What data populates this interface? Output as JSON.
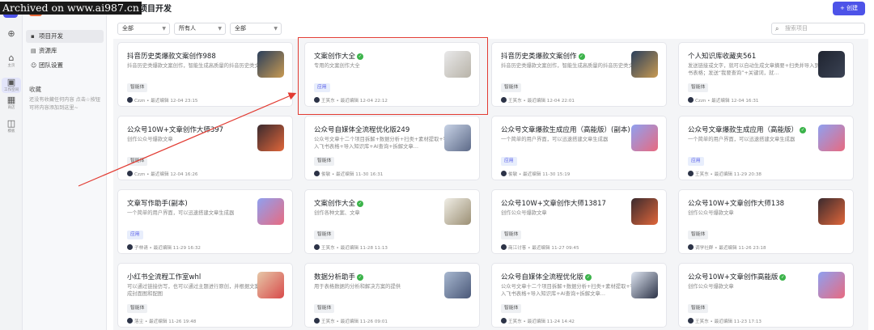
{
  "watermark": "Archived on www.ai987.cn",
  "rail": [
    {
      "icon": "⊕",
      "label": ""
    },
    {
      "icon": "⌂",
      "label": "主页"
    },
    {
      "icon": "▣",
      "label": "工作空间"
    },
    {
      "icon": "▦",
      "label": "商店"
    },
    {
      "icon": "◫",
      "label": "模板"
    }
  ],
  "sidebar": {
    "items": [
      {
        "icon": "▪",
        "label": "项目开发"
      },
      {
        "icon": "▤",
        "label": "资源库"
      },
      {
        "icon": "☺",
        "label": "团队设置"
      }
    ],
    "fav_title": "收藏",
    "fav_empty": "还没有收藏任何内容 点击☆按钮可将内容添加到这里~"
  },
  "header": {
    "title": "项目开发",
    "create_label": "+ 创建"
  },
  "filters": [
    {
      "value": "全部"
    },
    {
      "value": "所有人"
    },
    {
      "value": "全部"
    }
  ],
  "search": {
    "placeholder": "搜索项目"
  },
  "cards": [
    {
      "title": "抖音历史类爆款文案创作988",
      "verified": false,
      "desc": "抖音历史类爆款文案创作，智能生成高质量的抖音历史类文案",
      "tag": "智能体",
      "tag_type": "agent",
      "footer": "Czzn • 最近编辑 12-04 23:15"
    },
    {
      "title": "文案创作大全",
      "verified": true,
      "desc": "专用的文案创作大全",
      "tag": "应用",
      "tag_type": "app",
      "footer": "王笑东 • 最近编辑 12-04 22:12"
    },
    {
      "title": "抖音历史类爆款文案创作",
      "verified": true,
      "desc": "抖音历史类爆款文案创作，智能生成高质量的抖音历史类文案",
      "tag": "智能体",
      "tag_type": "agent",
      "footer": "王笑东 • 最近编辑 12-04 22:01"
    },
    {
      "title": "个人知识库收藏夹561",
      "verified": false,
      "desc": "发送链接或文字，就可以自动生成文章摘要+扫类并导入到飞书表格；发送“我要查询”+关键词，就…",
      "tag": "智能体",
      "tag_type": "agent",
      "footer": "Czzn • 最近编辑 12-04 16:31"
    },
    {
      "title": "公众号10W+文章创作大师397",
      "verified": false,
      "desc": "创作公众号爆款文章",
      "tag": "智能体",
      "tag_type": "agent",
      "footer": "Czzn • 最近编辑 12-04 16:26"
    },
    {
      "title": "公众号自媒体全流程优化版249",
      "verified": false,
      "desc": "公众号文章十二个项目拆解+数据分析+扫类+素材提取+导入飞书表格+导入知识库+AI查询+拆解文章…",
      "tag": "智能体",
      "tag_type": "agent",
      "footer": "俊敏 • 最近编辑 11-30 16:31"
    },
    {
      "title": "公众号文章爆款生成应用（高能版）(副本)",
      "verified": false,
      "desc": "一个简单的用户界面，可以迅速搭建文章生成器",
      "tag": "应用",
      "tag_type": "app",
      "footer": "俊敏 • 最近编辑 11-30 15:19"
    },
    {
      "title": "公众号文章爆款生成应用（高能版）",
      "verified": true,
      "desc": "一个简单的用户界面，可以迅速搭建文章生成器",
      "tag": "应用",
      "tag_type": "app",
      "footer": "王笑东 • 最近编辑 11-29 20:38"
    },
    {
      "title": "文章写作助手(副本)",
      "verified": false,
      "desc": "一个简单的用户界面，可以迅速搭建文章生成器",
      "tag": "应用",
      "tag_type": "app",
      "footer": "子林请 • 最近编辑 11-29 16:32"
    },
    {
      "title": "文案创作大全",
      "verified": true,
      "desc": "创作各种文案、文章",
      "tag": "智能体",
      "tag_type": "agent",
      "footer": "王笑东 • 最近编辑 11-28 11:13"
    },
    {
      "title": "公众号10W+文章创作大师13817",
      "verified": false,
      "desc": "创作公众号爆款文章",
      "tag": "智能体",
      "tag_type": "agent",
      "footer": "商江讨客 • 最近编辑 11-27 09:45"
    },
    {
      "title": "公众号10W+文章创作大师138",
      "verified": false,
      "desc": "创作公众号爆款文章",
      "tag": "智能体",
      "tag_type": "agent",
      "footer": "调学社群 • 最近编辑 11-26 23:18"
    },
    {
      "title": "小红书全流程工作室whl",
      "verified": false,
      "desc": "可以通过链接仿写，也可以通过主题进行原创，并根据文案生成封面图和配图",
      "tag": "智能体",
      "tag_type": "agent",
      "footer": "落尘 • 最近编辑 11-26 19:48"
    },
    {
      "title": "数据分析助手",
      "verified": true,
      "desc": "用于表格数据的分析和解决方案的提供",
      "tag": "智能体",
      "tag_type": "agent",
      "footer": "王笑东 • 最近编辑 11-26 09:01"
    },
    {
      "title": "公众号自媒体全流程优化版",
      "verified": true,
      "desc": "公众号文章十二个项目拆解+数据分析+扫类+素材提取+导入飞书表格+导入知识库+AI查询+拆解文章…",
      "tag": "智能体",
      "tag_type": "agent",
      "footer": "王笑东 • 最近编辑 11-24 14:42"
    },
    {
      "title": "公众号10W+文章创作高能版",
      "verified": true,
      "desc": "创作公众号爆款文章",
      "tag": "智能体",
      "tag_type": "agent",
      "footer": "王笑东 • 最近编辑 11-23 17:13"
    }
  ],
  "colors": {
    "accent": "#4d53e8",
    "highlight": "#e23b32",
    "verified": "#3bb34a"
  }
}
